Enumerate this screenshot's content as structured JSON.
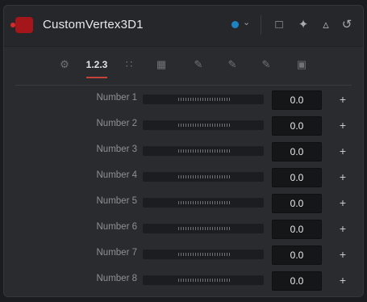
{
  "header": {
    "title": "CustomVertex3D1",
    "accent_color": "#1d83c4",
    "icons": [
      "close-icon",
      "color-dot-icon",
      "chevron-down-icon",
      "window-icon",
      "pin-icon",
      "lock-icon",
      "reset-icon"
    ]
  },
  "tabs": [
    {
      "name": "tab-controls",
      "label": "",
      "icon": "controls-icon",
      "active": false
    },
    {
      "name": "tab-numbers",
      "label": "1.2.3",
      "icon": "numbers-icon",
      "active": true
    },
    {
      "name": "tab-points",
      "label": "",
      "icon": "points-icon",
      "active": false
    },
    {
      "name": "tab-lut",
      "label": "",
      "icon": "lut-icon",
      "active": false
    },
    {
      "name": "tab-intermediates",
      "label": "",
      "icon": "brush-icon",
      "active": false
    },
    {
      "name": "tab-config",
      "label": "",
      "icon": "brush-icon",
      "active": false
    },
    {
      "name": "tab-settings2",
      "label": "",
      "icon": "brush-icon",
      "active": false
    },
    {
      "name": "tab-settings",
      "label": "",
      "icon": "camera-icon",
      "active": false
    }
  ],
  "rows": [
    {
      "label": "Number 1",
      "value": "0.0",
      "plus": "+",
      "fraction": 0.0
    },
    {
      "label": "Number 2",
      "value": "0.0",
      "plus": "+",
      "fraction": 0.0
    },
    {
      "label": "Number 3",
      "value": "0.0",
      "plus": "+",
      "fraction": 0.0
    },
    {
      "label": "Number 4",
      "value": "0.0",
      "plus": "+",
      "fraction": 0.0
    },
    {
      "label": "Number 5",
      "value": "0.0",
      "plus": "+",
      "fraction": 0.0
    },
    {
      "label": "Number 6",
      "value": "0.0",
      "plus": "+",
      "fraction": 0.0
    },
    {
      "label": "Number 7",
      "value": "0.0",
      "plus": "+",
      "fraction": 0.0
    },
    {
      "label": "Number 8",
      "value": "0.0",
      "plus": "+",
      "fraction": 0.0
    }
  ]
}
